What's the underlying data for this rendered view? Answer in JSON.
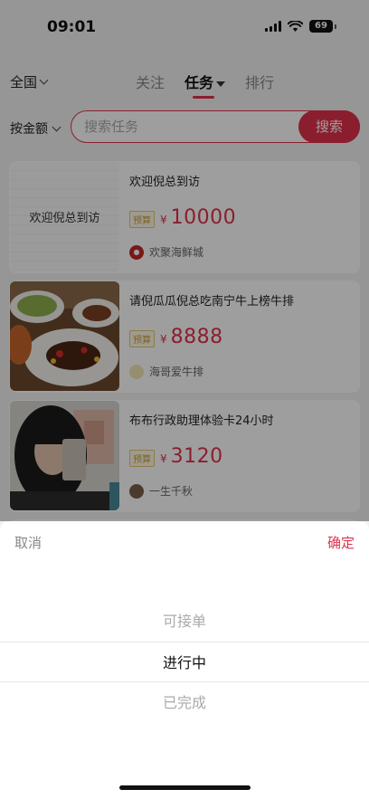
{
  "status": {
    "time": "09:01",
    "battery": "69"
  },
  "nav": {
    "region": "全国",
    "tabs": [
      {
        "label": "关注"
      },
      {
        "label": "任务"
      },
      {
        "label": "排行"
      }
    ]
  },
  "search": {
    "sort_label": "按金额",
    "placeholder": "搜索任务",
    "button": "搜索"
  },
  "tasks": [
    {
      "thumb_text": "欢迎倪总到访",
      "title": "欢迎倪总到访",
      "badge": "预算",
      "currency": "¥",
      "amount": "10000",
      "owner": "欢聚海鲜城"
    },
    {
      "title": "请倪瓜瓜倪总吃南宁牛上榜牛排",
      "badge": "预算",
      "currency": "¥",
      "amount": "8888",
      "owner": "海哥爱牛排"
    },
    {
      "title": "布布行政助理体验卡24小时",
      "badge": "预算",
      "currency": "¥",
      "amount": "3120",
      "owner": "一生千秋"
    }
  ],
  "sheet": {
    "cancel": "取消",
    "confirm": "确定",
    "options": [
      "可接单",
      "进行中",
      "已完成"
    ],
    "selected": "进行中"
  },
  "colors": {
    "accent": "#e0314b",
    "budget_badge": "#c9a13d"
  }
}
